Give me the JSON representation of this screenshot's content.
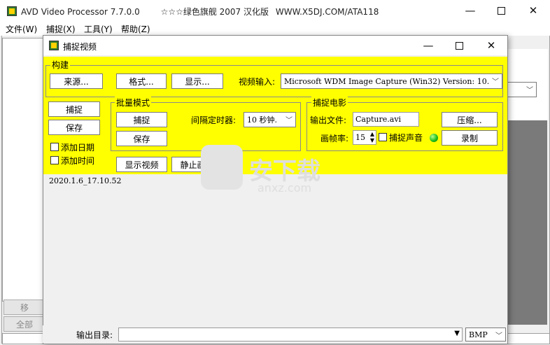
{
  "main_window": {
    "title": "AVD Video Processor 7.7.0.0",
    "subtitle": "☆☆☆绿色旗舰 2007 汉化版",
    "site": "WWW.X5DJ.COM/ATA118",
    "menu": [
      "文件(W)",
      "捕捉(X)",
      "工具(Y)",
      "帮助(Z)"
    ],
    "bg_buttons": [
      "移",
      "全部"
    ]
  },
  "dialog": {
    "title": "捕捉视频",
    "build_group": {
      "label": "构建",
      "source_btn": "来源...",
      "format_btn": "格式...",
      "display_btn": "显示...",
      "video_input_label": "视频输入:",
      "video_input_value": "Microsoft WDM Image Capture (Win32) Version:  10."
    },
    "left": {
      "capture_btn": "捕捉",
      "save_btn": "保存",
      "add_date": "添加日期",
      "add_time": "添加时间"
    },
    "batch_group": {
      "label": "批量模式",
      "capture_btn": "捕捉",
      "save_btn": "保存",
      "interval_label": "间隔定时器:",
      "interval_value": "10 秒钟."
    },
    "movie_group": {
      "label": "捕捉电影",
      "output_label": "输出文件:",
      "output_value": "Capture.avi",
      "compress_btn": "压缩...",
      "fps_label": "画帧率:",
      "fps_value": "15",
      "audio_label": "捕捉声音",
      "record_btn": "录制"
    },
    "show_video_btn": "显示视频",
    "freeze_btn": "静止画面",
    "log_line": "2020.1.6_17.10.52"
  },
  "bottom": {
    "output_dir_label": "输出目录:",
    "format_value": "BMP"
  },
  "watermark": {
    "cn": "安下载",
    "en": "anxz.com"
  }
}
